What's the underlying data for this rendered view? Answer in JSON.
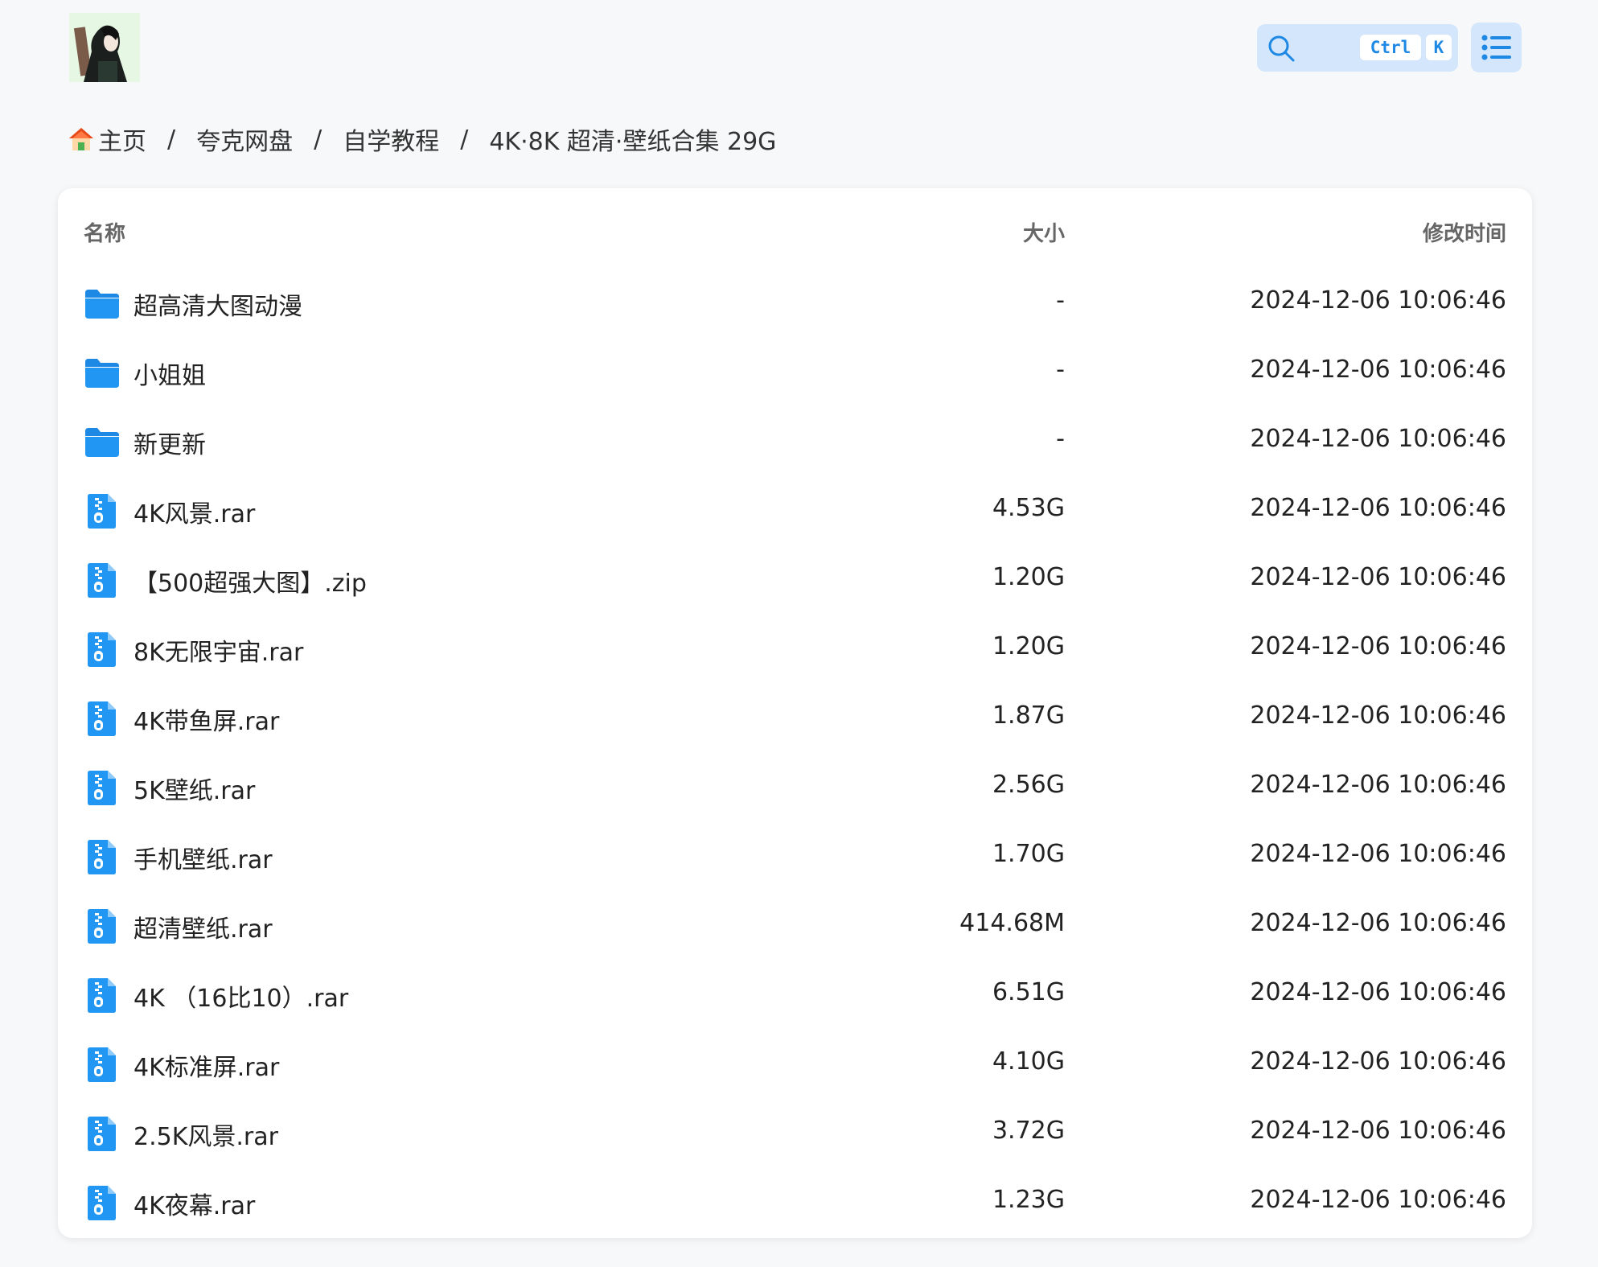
{
  "header": {
    "search_shortcut_ctrl": "Ctrl",
    "search_shortcut_key": "K"
  },
  "breadcrumb": {
    "home_label": "主页",
    "items": [
      "夸克网盘",
      "自学教程",
      "4K·8K 超清·壁纸合集 29G"
    ],
    "separator": "/"
  },
  "table": {
    "columns": {
      "name": "名称",
      "size": "大小",
      "modified": "修改时间"
    },
    "rows": [
      {
        "type": "folder",
        "name": "超高清大图动漫",
        "size": "-",
        "modified": "2024-12-06 10:06:46"
      },
      {
        "type": "folder",
        "name": "小姐姐",
        "size": "-",
        "modified": "2024-12-06 10:06:46"
      },
      {
        "type": "folder",
        "name": "新更新",
        "size": "-",
        "modified": "2024-12-06 10:06:46"
      },
      {
        "type": "archive",
        "name": "4K风景.rar",
        "size": "4.53G",
        "modified": "2024-12-06 10:06:46"
      },
      {
        "type": "archive",
        "name": "【500超强大图】.zip",
        "size": "1.20G",
        "modified": "2024-12-06 10:06:46"
      },
      {
        "type": "archive",
        "name": "8K无限宇宙.rar",
        "size": "1.20G",
        "modified": "2024-12-06 10:06:46"
      },
      {
        "type": "archive",
        "name": "4K带鱼屏.rar",
        "size": "1.87G",
        "modified": "2024-12-06 10:06:46"
      },
      {
        "type": "archive",
        "name": "5K壁纸.rar",
        "size": "2.56G",
        "modified": "2024-12-06 10:06:46"
      },
      {
        "type": "archive",
        "name": "手机壁纸.rar",
        "size": "1.70G",
        "modified": "2024-12-06 10:06:46"
      },
      {
        "type": "archive",
        "name": "超清壁纸.rar",
        "size": "414.68M",
        "modified": "2024-12-06 10:06:46"
      },
      {
        "type": "archive",
        "name": "4K （16比10）.rar",
        "size": "6.51G",
        "modified": "2024-12-06 10:06:46"
      },
      {
        "type": "archive",
        "name": "4K标准屏.rar",
        "size": "4.10G",
        "modified": "2024-12-06 10:06:46"
      },
      {
        "type": "archive",
        "name": "2.5K风景.rar",
        "size": "3.72G",
        "modified": "2024-12-06 10:06:46"
      },
      {
        "type": "archive",
        "name": "4K夜幕.rar",
        "size": "1.23G",
        "modified": "2024-12-06 10:06:46"
      }
    ]
  },
  "colors": {
    "accent": "#1e88e5",
    "icon_blue": "#2196f3",
    "search_bg": "#d3e6fb",
    "page_bg": "#f7f8fa"
  },
  "icons": {
    "home": "home-icon",
    "folder": "folder-icon",
    "archive": "archive-file-icon",
    "search": "search-icon",
    "menu": "list-menu-icon"
  }
}
